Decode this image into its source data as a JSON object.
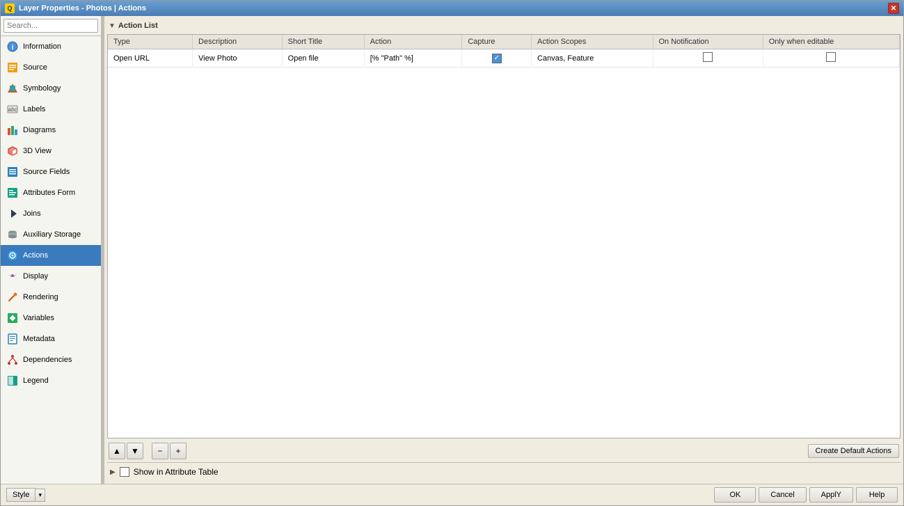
{
  "window": {
    "title": "Layer Properties - Photos | Actions",
    "icon": "Q"
  },
  "sidebar": {
    "search_placeholder": "Search...",
    "items": [
      {
        "id": "information",
        "label": "Information",
        "icon": "ℹ"
      },
      {
        "id": "source",
        "label": "Source",
        "icon": "◈"
      },
      {
        "id": "symbology",
        "label": "Symbology",
        "icon": "◆"
      },
      {
        "id": "labels",
        "label": "Labels",
        "icon": "abc"
      },
      {
        "id": "diagrams",
        "label": "Diagrams",
        "icon": "◉"
      },
      {
        "id": "3dview",
        "label": "3D View",
        "icon": "◈"
      },
      {
        "id": "source-fields",
        "label": "Source Fields",
        "icon": "⊞"
      },
      {
        "id": "attributes-form",
        "label": "Attributes Form",
        "icon": "⊟"
      },
      {
        "id": "joins",
        "label": "Joins",
        "icon": "◀"
      },
      {
        "id": "auxiliary-storage",
        "label": "Auxiliary Storage",
        "icon": "⊙"
      },
      {
        "id": "actions",
        "label": "Actions",
        "icon": "⚙",
        "active": true
      },
      {
        "id": "display",
        "label": "Display",
        "icon": "💬"
      },
      {
        "id": "rendering",
        "label": "Rendering",
        "icon": "✏"
      },
      {
        "id": "variables",
        "label": "Variables",
        "icon": "❖"
      },
      {
        "id": "metadata",
        "label": "Metadata",
        "icon": "📄"
      },
      {
        "id": "dependencies",
        "label": "Dependencies",
        "icon": "🔗"
      },
      {
        "id": "legend",
        "label": "Legend",
        "icon": "◧"
      }
    ]
  },
  "main": {
    "section_title": "Action List",
    "table": {
      "columns": [
        "Type",
        "Description",
        "Short Title",
        "Action",
        "Capture",
        "Action Scopes",
        "On Notification",
        "Only when editable"
      ],
      "rows": [
        {
          "type": "Open URL",
          "description": "View Photo",
          "short_title": "Open file",
          "action": "[% \"Path\" %]",
          "capture": true,
          "action_scopes": "Canvas, Feature",
          "on_notification": false,
          "only_when_editable": false
        }
      ]
    },
    "show_attr_table_label": "Show in Attribute Table",
    "create_default_actions_label": "Create Default Actions"
  },
  "bottom": {
    "style_label": "Style",
    "ok_label": "OK",
    "cancel_label": "Cancel",
    "apply_label": "ApplY",
    "help_label": "Help"
  }
}
